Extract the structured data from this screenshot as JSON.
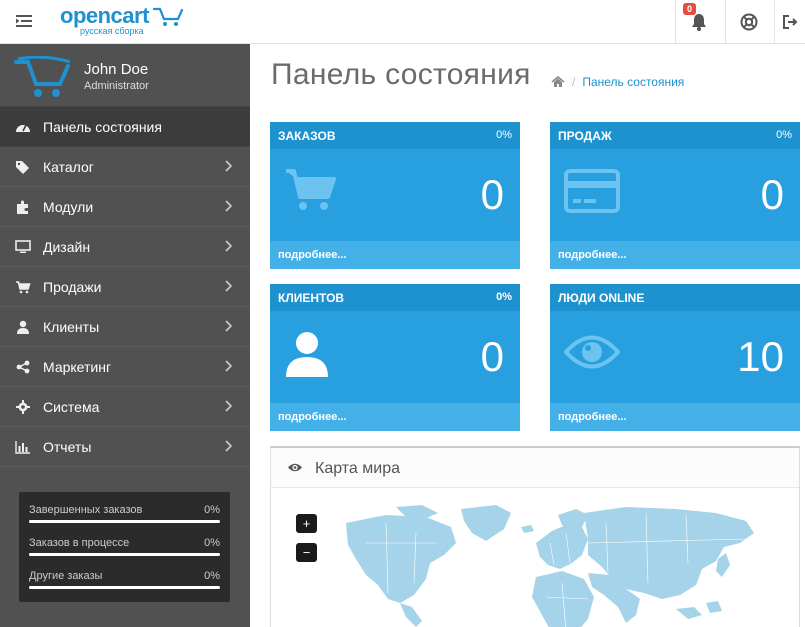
{
  "header": {
    "logo_text": "opencart",
    "logo_subtext": "русская сборка",
    "notifications_count": "0"
  },
  "sidebar": {
    "user_name": "John Doe",
    "user_role": "Administrator",
    "items": [
      {
        "label": "Панель состояния",
        "icon": "dashboard-icon"
      },
      {
        "label": "Каталог",
        "icon": "tags-icon"
      },
      {
        "label": "Модули",
        "icon": "puzzle-icon"
      },
      {
        "label": "Дизайн",
        "icon": "monitor-icon"
      },
      {
        "label": "Продажи",
        "icon": "cart-icon"
      },
      {
        "label": "Клиенты",
        "icon": "user-icon"
      },
      {
        "label": "Маркетинг",
        "icon": "share-icon"
      },
      {
        "label": "Система",
        "icon": "gear-icon"
      },
      {
        "label": "Отчеты",
        "icon": "bar-chart-icon"
      }
    ],
    "stats": [
      {
        "label": "Завершенных заказов",
        "value": "0%",
        "progress": 0
      },
      {
        "label": "Заказов в процессе",
        "value": "0%",
        "progress": 0
      },
      {
        "label": "Другие заказы",
        "value": "0%",
        "progress": 0
      }
    ]
  },
  "main": {
    "title": "Панель состояния",
    "breadcrumb": "Панель состояния",
    "tiles": [
      {
        "title": "ЗАКАЗОВ",
        "percent": "0%",
        "value": "0",
        "more": "подробнее..."
      },
      {
        "title": "ПРОДАЖ",
        "percent": "0%",
        "value": "0",
        "more": "подробнее..."
      },
      {
        "title": "КЛИЕНТОВ",
        "percent": "0%",
        "value": "0",
        "more": "подробнее..."
      },
      {
        "title": "ЛЮДИ ONLINE",
        "value": "10",
        "more": "подробнее..."
      }
    ],
    "map": {
      "title": "Карта мира",
      "zoom_in": "+",
      "zoom_out": "−"
    }
  },
  "colors": {
    "accent": "#1e91cf",
    "tile": "#28a0e0",
    "sidebar": "#515151",
    "map_land": "#a5d3ea"
  }
}
